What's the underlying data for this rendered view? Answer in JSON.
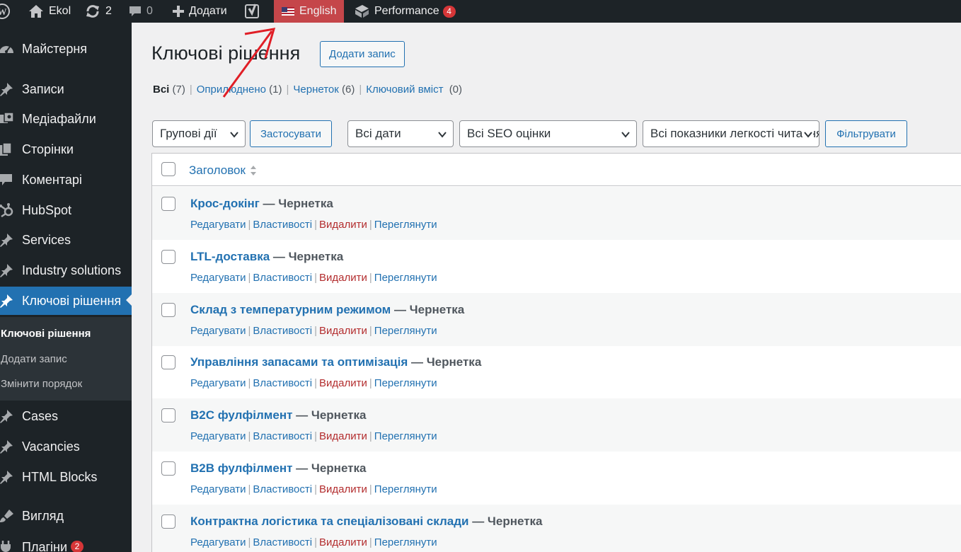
{
  "adminbar": {
    "site_name": "Ekol",
    "updates_count": "2",
    "comments_count": "0",
    "new_label": "Додати",
    "language_label": "English",
    "performance_label": "Performance",
    "performance_badge": "4",
    "icons": [
      "wordpress-icon",
      "home-icon",
      "updates-icon",
      "comments-icon",
      "plus-icon",
      "yoast-icon",
      "us-flag-icon",
      "performance-icon"
    ]
  },
  "sidebar": {
    "items": [
      {
        "label": "Майстерня",
        "icon": "dashboard-icon"
      },
      {
        "label": "Записи",
        "icon": "pin-icon"
      },
      {
        "label": "Медіафайли",
        "icon": "media-icon"
      },
      {
        "label": "Сторінки",
        "icon": "pages-icon"
      },
      {
        "label": "Коментарі",
        "icon": "comments-icon"
      },
      {
        "label": "HubSpot",
        "icon": "hubspot-icon"
      },
      {
        "label": "Services",
        "icon": "pin-icon"
      },
      {
        "label": "Industry solutions",
        "icon": "pin-icon"
      },
      {
        "label": "Ключові рішення",
        "icon": "pin-icon",
        "current": true
      },
      {
        "label": "Cases",
        "icon": "pin-icon"
      },
      {
        "label": "Vacancies",
        "icon": "pin-icon"
      },
      {
        "label": "HTML Blocks",
        "icon": "pin-icon"
      },
      {
        "label": "Вигляд",
        "icon": "appearance-icon"
      },
      {
        "label": "Плагіни",
        "icon": "plugins-icon",
        "badge": "2"
      }
    ],
    "submenu": [
      "Ключові рішення",
      "Додати запис",
      "Змінити порядок"
    ]
  },
  "main": {
    "title": "Ключові рішення",
    "add_new": "Додати запис",
    "views": [
      {
        "label": "Всі",
        "count": "(7)"
      },
      {
        "label": "Оприлюднено",
        "count": "(1)"
      },
      {
        "label": "Чернеток",
        "count": "(6)"
      },
      {
        "label": "Ключовий вміст",
        "count": "(0)"
      }
    ],
    "filters": {
      "bulk_actions": "Групові дії",
      "apply": "Застосувати",
      "dates": "Всі дати",
      "seo": "Всі SEO оцінки",
      "readability": "Всі показники легкості читання",
      "filter": "Фільтрувати"
    },
    "table": {
      "column_title": "Заголовок",
      "state_separator": " — ",
      "rows": [
        {
          "title": "Крос-докінг",
          "state": "Чернетка"
        },
        {
          "title": "LTL-доставка",
          "state": "Чернетка"
        },
        {
          "title": "Склад з температурним режимом",
          "state": "Чернетка"
        },
        {
          "title": "Управління запасами та оптимізація",
          "state": "Чернетка"
        },
        {
          "title": "B2C фулфілмент",
          "state": "Чернетка"
        },
        {
          "title": "B2B фулфілмент",
          "state": "Чернетка"
        },
        {
          "title": "Контрактна логістика та спеціалізовані склади",
          "state": "Чернетка"
        }
      ],
      "actions": {
        "edit": "Редагувати",
        "properties": "Властивості",
        "delete": "Видалити",
        "view": "Переглянути",
        "separator": "|"
      }
    }
  },
  "annotation_color": "#e01e26"
}
